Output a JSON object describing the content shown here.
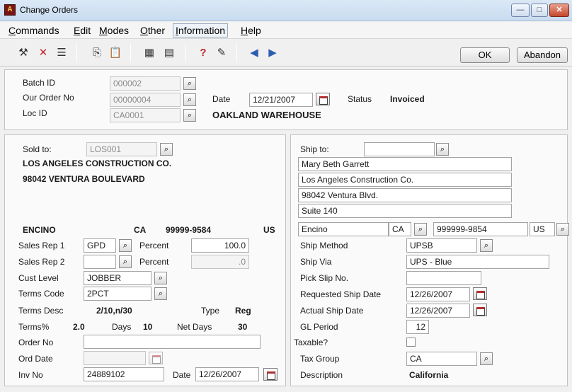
{
  "window": {
    "title": "Change Orders",
    "min": "—",
    "max": "□",
    "close": "✕"
  },
  "menu": [
    "Commands",
    "Edit",
    "Modes",
    "Other",
    "Information",
    "Help"
  ],
  "toolbar": {
    "icons": [
      "tools-icon",
      "delete-icon",
      "list-icon",
      "copy-icon",
      "paste-icon",
      "calculator-icon",
      "calendar-icon",
      "help-icon",
      "notes-icon",
      "back-icon",
      "forward-icon"
    ],
    "ok_label": "OK",
    "abandon_label": "Abandon"
  },
  "header": {
    "batch_id_label": "Batch ID",
    "batch_id": "000002",
    "order_no_label": "Our Order No",
    "order_no": "00000004",
    "loc_id_label": "Loc ID",
    "loc_id": "CA0001",
    "date_label": "Date",
    "date": "12/21/2007",
    "status_label": "Status",
    "status": "Invoiced",
    "location_name": "OAKLAND WAREHOUSE"
  },
  "sold_to": {
    "label": "Sold to:",
    "code": "LOS001",
    "name": "LOS ANGELES CONSTRUCTION CO.",
    "address": "98042 VENTURA BOULEVARD",
    "city": "ENCINO",
    "state": "CA",
    "zip": "99999-9584",
    "country": "US"
  },
  "sales": {
    "rep1_label": "Sales Rep 1",
    "rep1": "GPD",
    "percent_label": "Percent",
    "rep1_percent": "100.0",
    "rep2_label": "Sales Rep 2",
    "rep2": "",
    "rep2_percent": ".0",
    "cust_level_label": "Cust Level",
    "cust_level": "JOBBER",
    "terms_code_label": "Terms Code",
    "terms_code": "2PCT",
    "terms_desc_label": "Terms Desc",
    "terms_desc": "2/10,n/30",
    "type_label": "Type",
    "type": "Reg",
    "terms_pct_label": "Terms%",
    "terms_pct": "2.0",
    "days_label": "Days",
    "days": "10",
    "net_days_label": "Net Days",
    "net_days": "30",
    "order_no_label": "Order No",
    "order_no": "",
    "ord_date_label": "Ord Date",
    "ord_date": "",
    "inv_no_label": "Inv No",
    "inv_no": "24889102",
    "inv_date_label": "Date",
    "inv_date": "12/26/2007"
  },
  "ship_to": {
    "label": "Ship to:",
    "code": "",
    "lines": [
      "Mary Beth Garrett",
      "Los Angeles Construction Co.",
      "98042 Ventura Blvd.",
      "Suite 140"
    ],
    "city": "Encino",
    "state": "CA",
    "zip": "999999-9854",
    "country": "US",
    "ship_method_label": "Ship Method",
    "ship_method": "UPSB",
    "ship_via_label": "Ship Via",
    "ship_via": "UPS - Blue",
    "pick_slip_label": "Pick Slip No.",
    "pick_slip": "",
    "req_ship_label": "Requested Ship Date",
    "req_ship": "12/26/2007",
    "act_ship_label": "Actual Ship Date",
    "act_ship": "12/26/2007",
    "gl_period_label": "GL Period",
    "gl_period": "12",
    "taxable_label": "Taxable?",
    "tax_group_label": "Tax Group",
    "tax_group": "CA",
    "description_label": "Description",
    "description": "California"
  }
}
